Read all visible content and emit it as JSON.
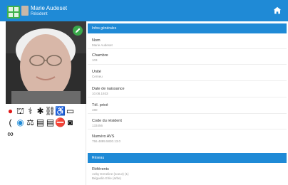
{
  "header": {
    "name": "Marie Audeset",
    "role": "Résident"
  },
  "sections": {
    "infos_title": "Infos générales",
    "fields": [
      {
        "label": "Nom",
        "value": "Marie Audeset"
      },
      {
        "label": "Chambre",
        "value": "103"
      },
      {
        "label": "Unité",
        "value": "Cerneu"
      },
      {
        "label": "Date de naissance",
        "value": "10.08.1933"
      },
      {
        "label": "Tél. privé",
        "value": "480"
      },
      {
        "label": "Code du résident",
        "value": "133456"
      },
      {
        "label": "Numéro AVS",
        "value": "756.4889.5830.13.0"
      }
    ],
    "reseau_title": "Réseau",
    "reseau": {
      "label": "Référents",
      "lines": [
        "Aeby Ermeline (soeur) (1)",
        "Béguelin Elrie (arbe)"
      ]
    }
  },
  "icons": [
    "blood-drop-icon",
    "bed-icon",
    "stethoscope-icon",
    "mobility-icon",
    "walker-icon",
    "wheelchair-icon",
    "denture-icon",
    "hearing-aid-icon",
    "meal-icon",
    "scale-icon",
    "document-icon",
    "document-icon",
    "no-entry-icon",
    "camera-icon",
    "glasses-icon"
  ],
  "colors": {
    "accent": "#1f8ad6",
    "edit": "#3aa84a",
    "warning": "#e01818"
  }
}
